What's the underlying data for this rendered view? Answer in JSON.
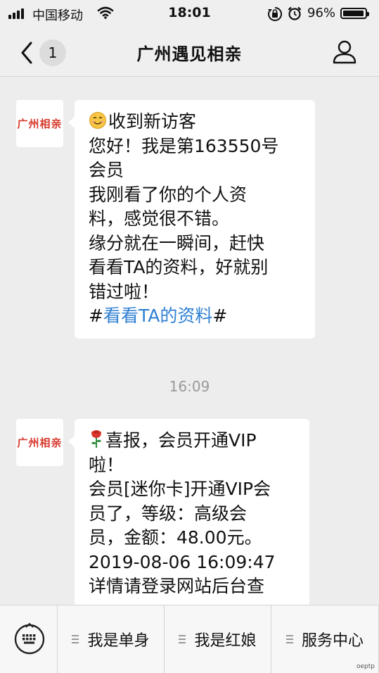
{
  "status_bar": {
    "carrier": "中国移动",
    "time": "18:01",
    "battery_pct": "96%",
    "battery_level": 0.96
  },
  "nav": {
    "unread_count": "1",
    "title": "广州遇见相亲"
  },
  "messages": [
    {
      "avatar_text": "广州相亲",
      "lines": [
        "收到新访客",
        "您好！我是第163550号",
        "会员",
        "我刚看了你的个人资",
        "料，感觉很不错。",
        "缘分就在一瞬间，赶快",
        "看看TA的资料，好就别",
        "错过啦！"
      ],
      "link_prefix": "#",
      "link_text": "看看TA的资料",
      "link_suffix": "#"
    },
    {
      "avatar_text": "广州相亲",
      "lines": [
        "喜报，会员开通VIP",
        "啦！",
        "会员[迷你卡]开通VIP会",
        "员了，等级：高级会",
        "员，金额：48.00元。",
        "2019-08-06 16:09:47",
        "详情请登录网站后台查"
      ]
    }
  ],
  "timestamp": "16:09",
  "menu": {
    "items": [
      "我是单身",
      "我是红娘",
      "服务中心"
    ]
  },
  "watermark": "oeptp",
  "colors": {
    "link": "#2f7fd3",
    "avatar_text": "#d83a2e",
    "background": "#ededed"
  },
  "icons": [
    "signal-icon",
    "wifi-icon",
    "lock-rotation-icon",
    "alarm-icon",
    "battery-icon",
    "back-chevron-icon",
    "profile-icon",
    "smile-emoji-icon",
    "rose-emoji-icon",
    "keyboard-icon"
  ]
}
